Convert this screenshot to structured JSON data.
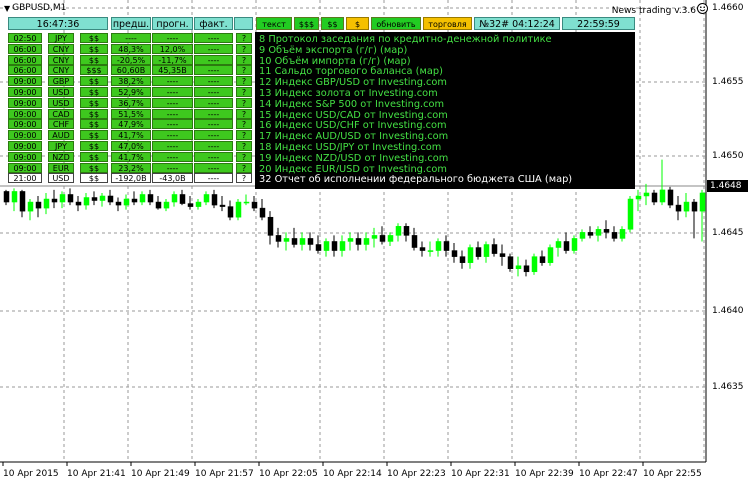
{
  "window": {
    "symbol": "GBPUSD,M1",
    "indicator": "News trading v.3.6"
  },
  "toolbar": {
    "clock": "16:47:36",
    "col_prev": "предш.",
    "col_forecast": "прогн.",
    "col_actual": "факт.",
    "btn_text": "текст",
    "btn_ddd": "$$$",
    "btn_dd": "$$",
    "btn_d": "$",
    "btn_refresh": "обновить",
    "btn_trade": "торговля",
    "next_event": "№32# 04:12:24",
    "server_time": "22:59:59"
  },
  "rows": [
    {
      "time": "02:50",
      "cur": "JPY",
      "imp": "$$",
      "prev": "----",
      "fcst": "----",
      "act": "----",
      "q": "?"
    },
    {
      "time": "06:00",
      "cur": "CNY",
      "imp": "$$",
      "prev": "48,3%",
      "fcst": "12,0%",
      "act": "----",
      "q": "?"
    },
    {
      "time": "06:00",
      "cur": "CNY",
      "imp": "$$",
      "prev": "-20,5%",
      "fcst": "-11,7%",
      "act": "----",
      "q": "?"
    },
    {
      "time": "06:00",
      "cur": "CNY",
      "imp": "$$$",
      "prev": "60,60B",
      "fcst": "45,35B",
      "act": "----",
      "q": "?"
    },
    {
      "time": "09:00",
      "cur": "GBP",
      "imp": "$$",
      "prev": "38,2%",
      "fcst": "----",
      "act": "----",
      "q": "?"
    },
    {
      "time": "09:00",
      "cur": "USD",
      "imp": "$$",
      "prev": "52,9%",
      "fcst": "----",
      "act": "----",
      "q": "?"
    },
    {
      "time": "09:00",
      "cur": "USD",
      "imp": "$$",
      "prev": "36,7%",
      "fcst": "----",
      "act": "----",
      "q": "?"
    },
    {
      "time": "09:00",
      "cur": "CAD",
      "imp": "$$",
      "prev": "51,5%",
      "fcst": "----",
      "act": "----",
      "q": "?"
    },
    {
      "time": "09:00",
      "cur": "CHF",
      "imp": "$$",
      "prev": "47,9%",
      "fcst": "----",
      "act": "----",
      "q": "?"
    },
    {
      "time": "09:00",
      "cur": "AUD",
      "imp": "$$",
      "prev": "41,7%",
      "fcst": "----",
      "act": "----",
      "q": "?"
    },
    {
      "time": "09:00",
      "cur": "JPY",
      "imp": "$$",
      "prev": "47,0%",
      "fcst": "----",
      "act": "----",
      "q": "?"
    },
    {
      "time": "09:00",
      "cur": "NZD",
      "imp": "$$",
      "prev": "41,7%",
      "fcst": "----",
      "act": "----",
      "q": "?"
    },
    {
      "time": "09:00",
      "cur": "EUR",
      "imp": "$$",
      "prev": "23,2%",
      "fcst": "----",
      "act": "----",
      "q": "?"
    },
    {
      "time": "21:00",
      "cur": "USD",
      "imp": "$$",
      "prev": "-192,0B",
      "fcst": "-43,0B",
      "act": "----",
      "q": "?"
    }
  ],
  "panel_lines": [
    "8 Протокол заседания по кредитно-денежной политике",
    "9 Объём экспорта (г/г) (мар)",
    "10 Объём импорта (г/г) (мар)",
    "11 Сальдо торгового баланса (мар)",
    "12 Индекс GBP/USD от Investing.com",
    "13 Индекс золота от Investing.com",
    "14 Индекс S&P 500 от Investing.com",
    "15 Индекс USD/CAD от Investing.com",
    "16 Индекс USD/CHF от Investing.com",
    "17 Индекс AUD/USD от Investing.com",
    "18 Индекс USD/JPY от Investing.com",
    "19 Индекс NZD/USD от Investing.com",
    "20 Индекс EUR/USD от Investing.com",
    "32 Отчет об исполнении федерального бюджета США (мар)"
  ],
  "colors": {
    "up": "#00ff00",
    "down": "#000000",
    "grid": "#9a9a9a",
    "table_green": "#3ec81e",
    "header_cyan": "#7fe0d0"
  },
  "price_axis": {
    "labels": [
      "1.4660",
      "1.4655",
      "1.4650",
      "1.4645",
      "1.4640",
      "1.4635"
    ],
    "current": "1.4648"
  },
  "time_axis": [
    "10 Apr 2015",
    "10 Apr 21:41",
    "10 Apr 21:49",
    "10 Apr 21:57",
    "10 Apr 22:05",
    "10 Apr 22:14",
    "10 Apr 22:23",
    "10 Apr 22:31",
    "10 Apr 22:39",
    "10 Apr 22:47",
    "10 Apr 22:55"
  ],
  "chart_data": {
    "type": "candlestick",
    "x": [
      "10 Apr 2015",
      "10 Apr 21:41",
      "10 Apr 21:49",
      "10 Apr 21:57",
      "10 Apr 22:05",
      "10 Apr 22:14",
      "10 Apr 22:23",
      "10 Apr 22:31",
      "10 Apr 22:39",
      "10 Apr 22:47",
      "10 Apr 22:55"
    ],
    "ylim": [
      1.4632,
      1.4662
    ],
    "candles": [
      [
        1.46479,
        1.4648,
        1.4647,
        1.46472
      ],
      [
        1.46472,
        1.46481,
        1.46466,
        1.46479
      ],
      [
        1.46479,
        1.4648,
        1.46462,
        1.46466
      ],
      [
        1.46466,
        1.46474,
        1.4646,
        1.46472
      ],
      [
        1.46472,
        1.46476,
        1.46462,
        1.46468
      ],
      [
        1.46468,
        1.46478,
        1.46464,
        1.46474
      ],
      [
        1.46474,
        1.4648,
        1.46468,
        1.46472
      ],
      [
        1.46472,
        1.46479,
        1.46468,
        1.46477
      ],
      [
        1.46477,
        1.46481,
        1.4647,
        1.46472
      ],
      [
        1.46472,
        1.46476,
        1.46466,
        1.4647
      ],
      [
        1.4647,
        1.46478,
        1.46467,
        1.46475
      ],
      [
        1.46475,
        1.46479,
        1.4647,
        1.46473
      ],
      [
        1.46473,
        1.46478,
        1.46469,
        1.46476
      ],
      [
        1.46476,
        1.4648,
        1.4647,
        1.46472
      ],
      [
        1.46472,
        1.46475,
        1.46466,
        1.4647
      ],
      [
        1.4647,
        1.46477,
        1.46467,
        1.46474
      ],
      [
        1.46474,
        1.46479,
        1.4647,
        1.46472
      ],
      [
        1.46472,
        1.46479,
        1.4647,
        1.46477
      ],
      [
        1.46477,
        1.4648,
        1.4647,
        1.46472
      ],
      [
        1.46472,
        1.46476,
        1.46467,
        1.46468
      ],
      [
        1.46468,
        1.46474,
        1.46466,
        1.46472
      ],
      [
        1.46472,
        1.46479,
        1.46469,
        1.46477
      ],
      [
        1.46477,
        1.4648,
        1.4647,
        1.46471
      ],
      [
        1.46471,
        1.46476,
        1.46467,
        1.46469
      ],
      [
        1.46469,
        1.46474,
        1.46467,
        1.46472
      ],
      [
        1.46472,
        1.46479,
        1.4647,
        1.46477
      ],
      [
        1.46477,
        1.4648,
        1.46468,
        1.4647
      ],
      [
        1.4647,
        1.46476,
        1.46466,
        1.46469
      ],
      [
        1.46469,
        1.46473,
        1.4646,
        1.46462
      ],
      [
        1.46462,
        1.46474,
        1.4646,
        1.46472
      ],
      [
        1.46472,
        1.46477,
        1.4647,
        1.46472
      ],
      [
        1.46472,
        1.46476,
        1.46466,
        1.46468
      ],
      [
        1.46468,
        1.46474,
        1.4646,
        1.46462
      ],
      [
        1.46462,
        1.46466,
        1.46444,
        1.4645
      ],
      [
        1.4645,
        1.46455,
        1.46442,
        1.46446
      ],
      [
        1.46446,
        1.46452,
        1.4644,
        1.46448
      ],
      [
        1.46448,
        1.46455,
        1.46442,
        1.46444
      ],
      [
        1.46444,
        1.46452,
        1.4644,
        1.46448
      ],
      [
        1.46448,
        1.46452,
        1.4644,
        1.46444
      ],
      [
        1.46444,
        1.4645,
        1.46438,
        1.4644
      ],
      [
        1.4644,
        1.46448,
        1.46436,
        1.46446
      ],
      [
        1.46446,
        1.4645,
        1.46436,
        1.4644
      ],
      [
        1.4644,
        1.4645,
        1.46436,
        1.46446
      ],
      [
        1.46446,
        1.46452,
        1.4644,
        1.46448
      ],
      [
        1.46448,
        1.46452,
        1.4644,
        1.46444
      ],
      [
        1.46444,
        1.46452,
        1.4644,
        1.46448
      ],
      [
        1.46448,
        1.46455,
        1.46442,
        1.4645
      ],
      [
        1.4645,
        1.46456,
        1.46444,
        1.46446
      ],
      [
        1.46446,
        1.46452,
        1.46443,
        1.4645
      ],
      [
        1.4645,
        1.46458,
        1.46446,
        1.46456
      ],
      [
        1.46456,
        1.46458,
        1.46446,
        1.4645
      ],
      [
        1.4645,
        1.46455,
        1.4644,
        1.46442
      ],
      [
        1.46442,
        1.46446,
        1.46436,
        1.4644
      ],
      [
        1.4644,
        1.46446,
        1.46436,
        1.4644
      ],
      [
        1.4644,
        1.46448,
        1.46436,
        1.46446
      ],
      [
        1.46446,
        1.4645,
        1.46436,
        1.4644
      ],
      [
        1.4644,
        1.46445,
        1.46432,
        1.46436
      ],
      [
        1.46436,
        1.4644,
        1.46428,
        1.46432
      ],
      [
        1.46432,
        1.46444,
        1.46428,
        1.46442
      ],
      [
        1.46442,
        1.46446,
        1.46434,
        1.46436
      ],
      [
        1.46436,
        1.46446,
        1.46432,
        1.46444
      ],
      [
        1.46444,
        1.46448,
        1.46436,
        1.46438
      ],
      [
        1.46438,
        1.46444,
        1.4643,
        1.46436
      ],
      [
        1.46436,
        1.46438,
        1.46426,
        1.46428
      ],
      [
        1.46428,
        1.46436,
        1.46423,
        1.4643
      ],
      [
        1.4643,
        1.46434,
        1.46423,
        1.46426
      ],
      [
        1.46426,
        1.46438,
        1.46424,
        1.46436
      ],
      [
        1.46436,
        1.4644,
        1.4643,
        1.46432
      ],
      [
        1.46432,
        1.46444,
        1.4643,
        1.46442
      ],
      [
        1.46442,
        1.46448,
        1.46436,
        1.46446
      ],
      [
        1.46446,
        1.46452,
        1.46438,
        1.4644
      ],
      [
        1.4644,
        1.4645,
        1.46438,
        1.46448
      ],
      [
        1.46448,
        1.46454,
        1.46446,
        1.46452
      ],
      [
        1.46452,
        1.46456,
        1.46448,
        1.4645
      ],
      [
        1.4645,
        1.46456,
        1.46446,
        1.46454
      ],
      [
        1.46454,
        1.4646,
        1.46448,
        1.46452
      ],
      [
        1.46452,
        1.46456,
        1.46446,
        1.46448
      ],
      [
        1.46448,
        1.46456,
        1.46446,
        1.46454
      ],
      [
        1.46454,
        1.46476,
        1.46452,
        1.46474
      ],
      [
        1.46474,
        1.4648,
        1.46466,
        1.46476
      ],
      [
        1.46476,
        1.46484,
        1.4647,
        1.46478
      ],
      [
        1.46478,
        1.4648,
        1.4647,
        1.46472
      ],
      [
        1.46472,
        1.465,
        1.4647,
        1.4648
      ],
      [
        1.4648,
        1.46482,
        1.46468,
        1.4647
      ],
      [
        1.4647,
        1.46476,
        1.4646,
        1.46466
      ],
      [
        1.46466,
        1.46478,
        1.46462,
        1.46472
      ],
      [
        1.46472,
        1.46474,
        1.46448,
        1.46466
      ],
      [
        1.46466,
        1.4648,
        1.46446,
        1.46478
      ],
      [
        1.46478,
        1.4648,
        1.4645,
        1.46456
      ]
    ]
  }
}
